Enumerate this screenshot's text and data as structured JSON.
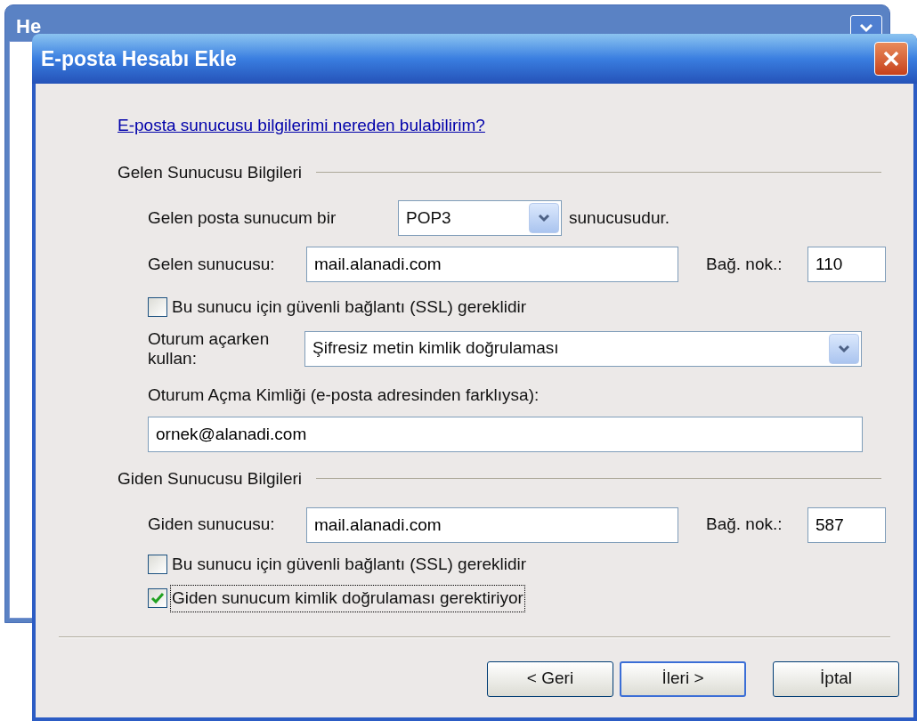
{
  "background_window": {
    "title": "He"
  },
  "dialog": {
    "title": "E-posta Hesabı Ekle",
    "help_link": "E-posta sunucusu bilgilerimi nereden bulabilirim?",
    "incoming": {
      "heading": "Gelen Sunucusu Bilgileri",
      "type_label": "Gelen posta sunucum bir",
      "type_value": "POP3",
      "type_suffix": "sunucusudur.",
      "server_label": "Gelen sunucusu:",
      "server_value": "mail.alanadi.com",
      "port_label": "Bağ. nok.:",
      "port_value": "110",
      "ssl": {
        "label": "Bu sunucu için güvenli bağlantı (SSL) gereklidir",
        "checked": false
      },
      "logon_label": "Oturum açarken kullan:",
      "logon_value": "Şifresiz metin kimlik doğrulaması",
      "login_id_label": "Oturum Açma Kimliği (e-posta adresinden farklıysa):",
      "login_id_value": "ornek@alanadi.com"
    },
    "outgoing": {
      "heading": "Giden Sunucusu Bilgileri",
      "server_label": "Giden sunucusu:",
      "server_value": "mail.alanadi.com",
      "port_label": "Bağ. nok.:",
      "port_value": "587",
      "checkboxes": [
        {
          "label": "Bu sunucu için güvenli bağlantı (SSL) gereklidir",
          "checked": false,
          "focused": false
        },
        {
          "label": "Giden sunucum kimlik doğrulaması gerektiriyor",
          "checked": true,
          "focused": true
        }
      ]
    },
    "buttons": [
      {
        "label": "< Geri",
        "default": false
      },
      {
        "label": "İleri >",
        "default": true
      },
      {
        "label": "İptal",
        "default": false
      }
    ]
  }
}
